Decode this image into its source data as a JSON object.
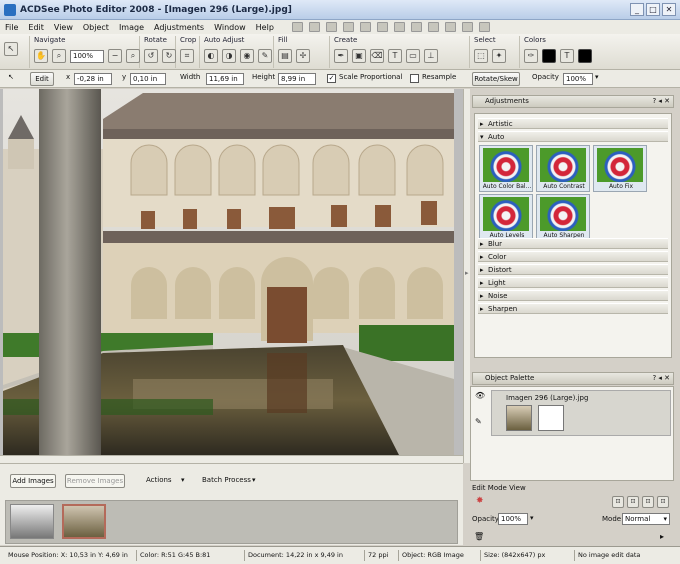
{
  "window": {
    "title": "ACDSee Photo Editor 2008 - [Imagen 296 (Large).jpg]"
  },
  "menu": [
    "File",
    "Edit",
    "View",
    "Object",
    "Image",
    "Adjustments",
    "Window",
    "Help"
  ],
  "ribbon": {
    "groups": [
      "Navigate",
      "Rotate",
      "Crop",
      "Auto Adjust",
      "Fill",
      "Create",
      "Select",
      "Colors"
    ],
    "zoom": "100%"
  },
  "editbar": {
    "edit_label": "Edit",
    "x_label": "x",
    "x_value": "-0,28 in",
    "y_label": "y",
    "y_value": "0,10 in",
    "width_label": "Width",
    "width_value": "11,69 in",
    "height_label": "Height",
    "height_value": "8,99 in",
    "scale_label": "Scale Proportional",
    "resample_label": "Resample",
    "rotate_label": "Rotate/Skew",
    "opacity_label": "Opacity",
    "opacity_value": "100%"
  },
  "basket": {
    "add_images": "Add Images",
    "remove_images": "Remove Images",
    "actions": "Actions",
    "batch_process": "Batch Process"
  },
  "adjustments": {
    "title": "Adjustments",
    "categories_top": [
      "Artistic",
      "Auto"
    ],
    "presets": [
      "Auto Color Bal...",
      "Auto Contrast",
      "Auto Fix",
      "Auto Levels",
      "Auto Sharpen"
    ],
    "categories_bottom": [
      "Blur",
      "Color",
      "Distort",
      "Light",
      "Noise",
      "Sharpen"
    ]
  },
  "object_palette": {
    "title": "Object Palette",
    "item_name": "Imagen 296 (Large).jpg"
  },
  "edit_mode": {
    "title": "Edit Mode View",
    "opacity_label": "Opacity",
    "opacity_value": "100%",
    "mode_label": "Mode",
    "mode_value": "Normal"
  },
  "status": {
    "mouse": "Mouse Position: X: 10,53 in  Y: 4,69 in",
    "color": "Color: R:51  G:45  B:81",
    "document": "Document: 14,22 in x 9,49 in",
    "ppi": "72 ppi",
    "object": "Object: RGB Image",
    "size": "Size: (842x647) px",
    "edit_data": "No image edit data"
  }
}
